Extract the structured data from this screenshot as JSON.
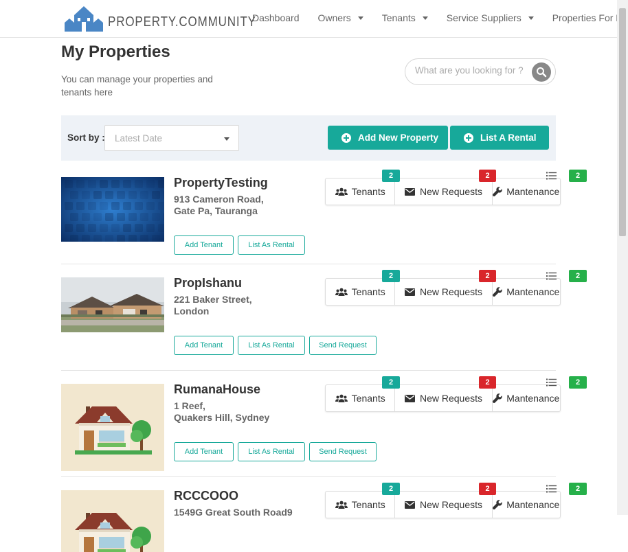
{
  "brand": {
    "name": "PROPERTY.COMMUNITY"
  },
  "nav": [
    {
      "label": "Dashboard",
      "dropdown": false
    },
    {
      "label": "Owners",
      "dropdown": true
    },
    {
      "label": "Tenants",
      "dropdown": true
    },
    {
      "label": "Service Suppliers",
      "dropdown": true
    },
    {
      "label": "Properties For R",
      "dropdown": false
    }
  ],
  "header": {
    "title": "My Properties",
    "subtitle": "You can manage your properties and tenants here",
    "search_placeholder": "What are you looking for ?"
  },
  "sort": {
    "label": "Sort by :",
    "value": "Latest Date"
  },
  "actions": {
    "add_property": "Add New Property",
    "list_rental": "List A Rental"
  },
  "stat_labels": {
    "tenants": "Tenants",
    "requests": "New Requests",
    "maintenance": "Mantenance"
  },
  "properties": [
    {
      "name": "PropertyTesting",
      "address_line1": "913 Cameron Road,",
      "address_line2": "Gate Pa, Tauranga",
      "buttons": [
        "Add Tenant",
        "List As Rental"
      ],
      "tenants_count": "2",
      "requests_count": "2",
      "maintenance_count": "2",
      "image": "blue-tiles"
    },
    {
      "name": "PropIshanu",
      "address_line1": "221 Baker Street,",
      "address_line2": "London",
      "buttons": [
        "Add Tenant",
        "List As Rental",
        "Send Request"
      ],
      "tenants_count": "2",
      "requests_count": "2",
      "maintenance_count": "2",
      "image": "house-photo"
    },
    {
      "name": "RumanaHouse",
      "address_line1": "1 Reef,",
      "address_line2": "Quakers Hill, Sydney",
      "buttons": [
        "Add Tenant",
        "List As Rental",
        "Send Request"
      ],
      "tenants_count": "2",
      "requests_count": "2",
      "maintenance_count": "2",
      "image": "house-illustration"
    },
    {
      "name": "RCCCOOO",
      "address_line1": "1549G Great South Road9",
      "address_line2": "",
      "buttons": [],
      "tenants_count": "2",
      "requests_count": "2",
      "maintenance_count": "2",
      "image": "house-illustration"
    }
  ],
  "colors": {
    "teal": "#17a99a",
    "red": "#d9262b",
    "green": "#26b04a",
    "sort_bg": "#eef2f7"
  }
}
